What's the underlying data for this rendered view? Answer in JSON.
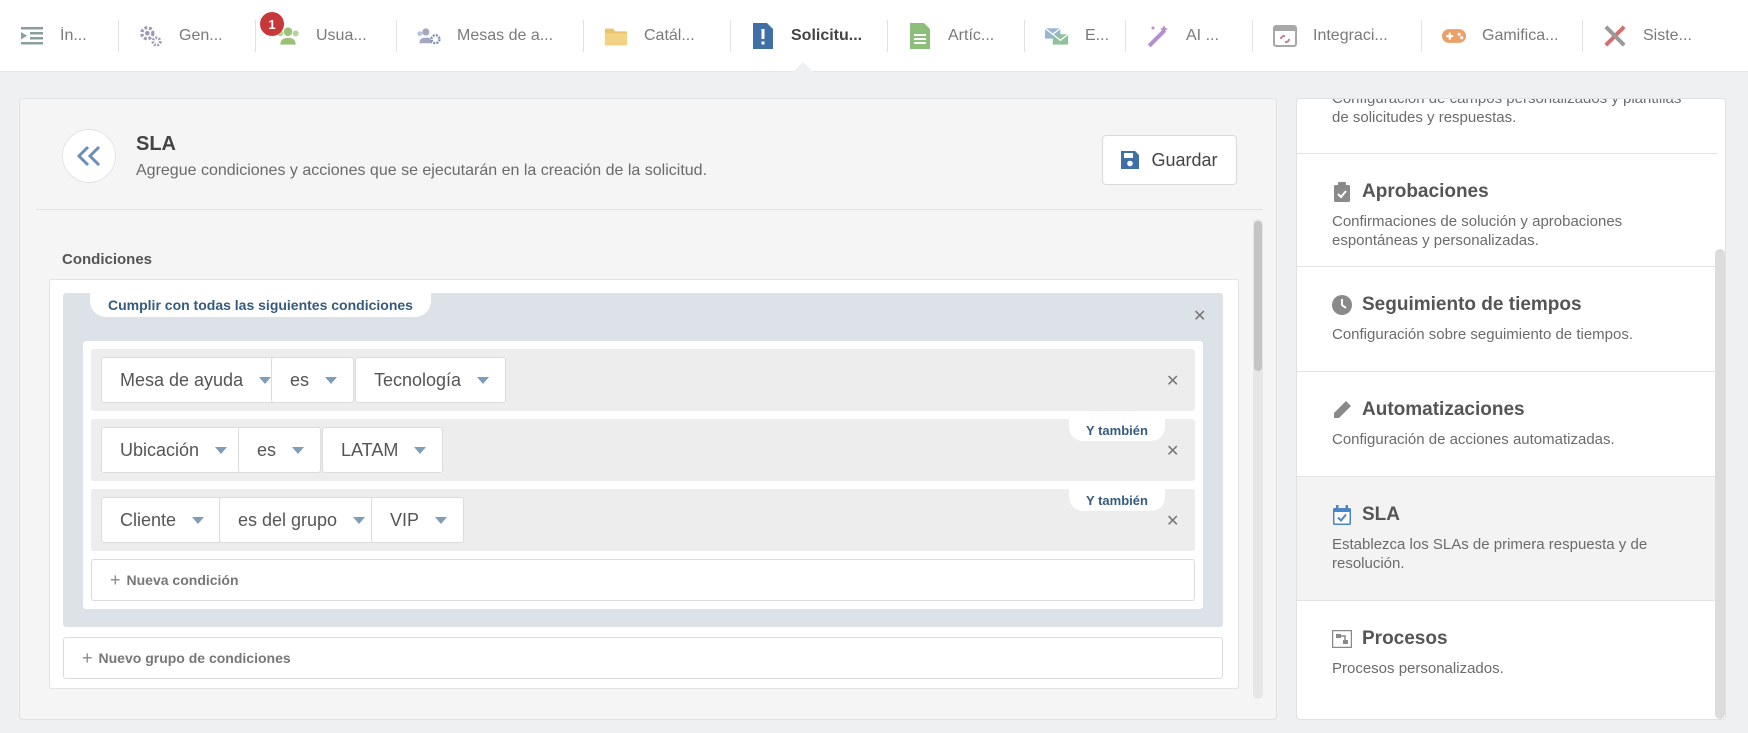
{
  "nav": {
    "items": [
      {
        "label": "Ín...",
        "icon": "indent-list-icon"
      },
      {
        "label": "Gen...",
        "icon": "gears-icon"
      },
      {
        "label": "Usua...",
        "icon": "users-icon"
      },
      {
        "label": "Mesas de a...",
        "icon": "users-gear-icon"
      },
      {
        "label": "Catál...",
        "icon": "folder-icon"
      },
      {
        "label": "Solicitu...",
        "icon": "request-exclamation-icon"
      },
      {
        "label": "Artíc...",
        "icon": "document-icon"
      },
      {
        "label": "E...",
        "icon": "envelopes-icon"
      },
      {
        "label": "AI ...",
        "icon": "magic-wand-icon"
      },
      {
        "label": "Integraci...",
        "icon": "browser-link-icon"
      },
      {
        "label": "Gamifica...",
        "icon": "gamepad-icon"
      },
      {
        "label": "Siste...",
        "icon": "tools-icon"
      }
    ],
    "users_badge": "1",
    "active_index": 5
  },
  "header": {
    "title": "SLA",
    "subtitle": "Agregue condiciones y acciones que se ejecutarán en la creación de la solicitud.",
    "save_label": "Guardar"
  },
  "conditions": {
    "title": "Condiciones",
    "group_label": "Cumplir con todas las siguientes condiciones",
    "rows": [
      {
        "field": "Mesa de ayuda",
        "operator": "es",
        "value": "Tecnología",
        "connector": ""
      },
      {
        "field": "Ubicación",
        "operator": "es",
        "value": "LATAM",
        "connector": "Y también"
      },
      {
        "field": "Cliente",
        "operator": "es del grupo",
        "value": "VIP",
        "connector": "Y también"
      }
    ],
    "new_condition": "Nueva condición",
    "new_group": "Nuevo grupo de condiciones"
  },
  "side": {
    "items": [
      {
        "title": "",
        "desc": "Configuración de campos personalizados y plantillas de solicitudes y respuestas.",
        "icon": ""
      },
      {
        "title": "Aprobaciones",
        "desc": "Confirmaciones de solución y aprobaciones espontáneas y personalizadas.",
        "icon": "clipboard-check-icon"
      },
      {
        "title": "Seguimiento de tiempos",
        "desc": "Configuración sobre seguimiento de tiempos.",
        "icon": "clock-icon"
      },
      {
        "title": "Automatizaciones",
        "desc": "Configuración de acciones automatizadas.",
        "icon": "pencil-icon"
      },
      {
        "title": "SLA",
        "desc": "Establezca los SLAs de primera respuesta y de resolución.",
        "icon": "calendar-check-icon"
      },
      {
        "title": "Procesos",
        "desc": "Procesos personalizados.",
        "icon": "process-icon"
      }
    ]
  },
  "colors": {
    "accent": "#355b7f",
    "badge": "#c6383a",
    "sla_icon": "#4a86c5"
  }
}
